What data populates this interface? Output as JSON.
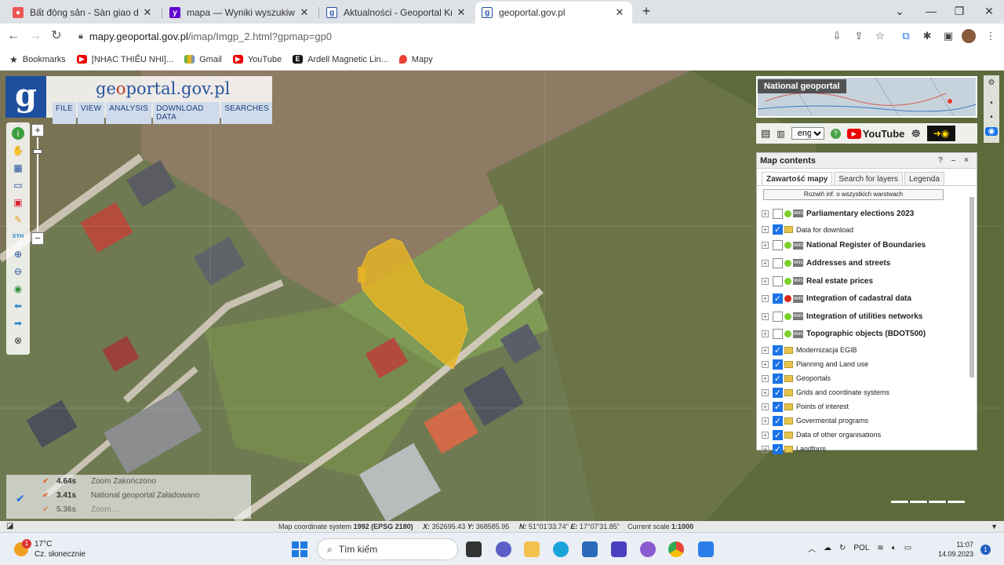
{
  "browser": {
    "tabs": [
      {
        "title": "Bất động sản - Sàn giao dịch bất",
        "favicon": "red-globe-icon"
      },
      {
        "title": "mapa — Wyniki wyszukiwarki Yah",
        "favicon": "yahoo-icon"
      },
      {
        "title": "Aktualności - Geoportal Krajowy",
        "favicon": "geoportal-icon"
      },
      {
        "title": "geoportal.gov.pl",
        "favicon": "geoportal-icon",
        "active": true
      }
    ],
    "url_host": "mapy.geoportal.gov.pl",
    "url_path": "/imap/Imgp_2.html?gpmap=gp0",
    "bookmarks": [
      {
        "label": "Bookmarks",
        "icon": "star-icon"
      },
      {
        "label": "[NHẠC THIẾU NHI]...",
        "icon": "youtube-icon"
      },
      {
        "label": "Gmail",
        "icon": "drive-icon"
      },
      {
        "label": "YouTube",
        "icon": "youtube-icon"
      },
      {
        "label": "Ardell Magnetic Lin...",
        "icon": "e-icon"
      },
      {
        "label": "Mapy",
        "icon": "maps-pin-icon"
      }
    ]
  },
  "geoportal": {
    "logo_letter": "g",
    "title_prefix": "ge",
    "title_accent": "o",
    "title_suffix": "portal.gov.pl",
    "menu": [
      "FILE",
      "VIEW",
      "ANALYSIS",
      "DOWNLOAD DATA",
      "SEARCHES"
    ],
    "overview_label": "National geoportal",
    "language": "eng",
    "youtube_label": "YouTube",
    "contents": {
      "title": "Map contents",
      "controls": "? – ×",
      "tabs": [
        "Zawartość mapy",
        "Search for layers",
        "Legenda"
      ],
      "expand_all": "Rozwiń inf. o wszystkich warstwach",
      "layers": [
        {
          "name": "Parliamentary elections 2023",
          "checked": false,
          "status": "green",
          "type": "wms"
        },
        {
          "name": "Data for download",
          "checked": true,
          "status": "",
          "type": "folder"
        },
        {
          "name": "National Register of Boundaries",
          "checked": false,
          "status": "green",
          "type": "wms"
        },
        {
          "name": "Addresses and streets",
          "checked": false,
          "status": "green",
          "type": "wms"
        },
        {
          "name": "Real estate prices",
          "checked": false,
          "status": "green",
          "type": "wms"
        },
        {
          "name": "Integration of cadastral data",
          "checked": true,
          "status": "red",
          "type": "wms"
        },
        {
          "name": "Integration of utilities networks",
          "checked": false,
          "status": "green",
          "type": "wms"
        },
        {
          "name": "Topographic objects (BDOT500)",
          "checked": false,
          "status": "green",
          "type": "wms"
        },
        {
          "name": "Modernizacja EGIB",
          "checked": true,
          "status": "",
          "type": "folder"
        },
        {
          "name": "Planning and Land use",
          "checked": true,
          "status": "",
          "type": "folder"
        },
        {
          "name": "Geoportals",
          "checked": true,
          "status": "",
          "type": "folder"
        },
        {
          "name": "Grids and coordinate systems",
          "checked": true,
          "status": "",
          "type": "folder"
        },
        {
          "name": "Points of interest",
          "checked": true,
          "status": "",
          "type": "folder"
        },
        {
          "name": "Govermental programs",
          "checked": true,
          "status": "",
          "type": "folder"
        },
        {
          "name": "Data of other organisations",
          "checked": true,
          "status": "",
          "type": "folder"
        },
        {
          "name": "Landform",
          "checked": true,
          "status": "",
          "type": "folder"
        }
      ]
    },
    "log": [
      {
        "time": "4.64s",
        "text": "Zoom  Zakończono"
      },
      {
        "time": "3.41s",
        "text": "National geoportal  Załadowano"
      },
      {
        "time": "5.36s",
        "text": "Zoom ..."
      }
    ],
    "coords": {
      "system_label": "Map coordinate system",
      "system_value": "1992 (EPSG 2180)",
      "x_label": "X:",
      "x": "352695.43",
      "y_label": "Y:",
      "y": "368585.95",
      "n_label": "N:",
      "n": "51°01'33.74\"",
      "e_label": "E:",
      "e": "17°07'31.85\"",
      "scale_label": "Current scale",
      "scale": "1:1000"
    }
  },
  "taskbar": {
    "temperature": "17°C",
    "weather": "Cz. słonecznie",
    "weather_badge": "1",
    "search_placeholder": "Tìm kiếm",
    "language": "POL",
    "time": "11:07",
    "date": "14.09.2023",
    "notifications": "1"
  },
  "colors": {
    "parcel_highlight": "#e6b422",
    "geoportal_blue": "#1e4f9e",
    "checkbox_blue": "#1a73e8"
  }
}
